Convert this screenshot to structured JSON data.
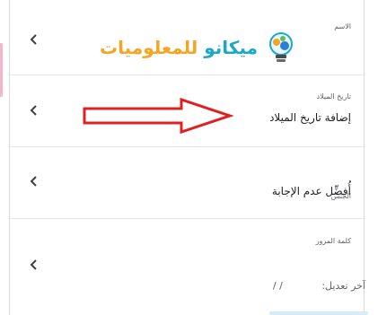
{
  "fields": {
    "name": {
      "label": "الاسم",
      "logo_text_a": "ميكانو",
      "logo_text_b": "للمعلوميات"
    },
    "birthday": {
      "label": "تاريخ الميلاد",
      "value": "إضافة تاريخ الميلاد"
    },
    "gender": {
      "label": "الجنس",
      "value": "أُفضِّل عدم الإجابة"
    },
    "password": {
      "label": "كلمة المرور",
      "modified_prefix": "آخر تعديل:",
      "modified_value": "/ /"
    }
  },
  "colors": {
    "annotation_red": "#e02020",
    "logo_orange": "#f5a524",
    "logo_blue": "#1aa9c9"
  }
}
